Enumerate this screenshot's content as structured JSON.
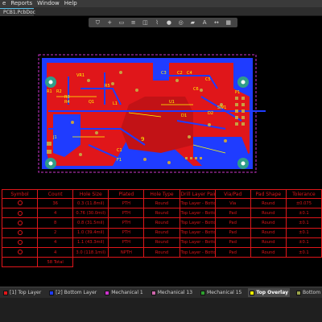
{
  "menu": [
    "e",
    "Reports",
    "Window",
    "Help"
  ],
  "document_tab": {
    "label": "PCB1.PcbDoc"
  },
  "toolbar_icons": [
    "filter-icon",
    "add-icon",
    "select-icon",
    "align-icon",
    "place-icon",
    "route-icon",
    "pad-icon",
    "via-icon",
    "region-icon",
    "text-icon",
    "dimension-icon",
    "component-icon"
  ],
  "board": {
    "designators": [
      "VR1",
      "R1",
      "R2",
      "Q1",
      "C3",
      "C2",
      "C4",
      "C5",
      "C6",
      "R3",
      "R4",
      "R5",
      "D1",
      "J1",
      "L1",
      "U1",
      "P1",
      "F1",
      "C1",
      "D2",
      "SW1"
    ]
  },
  "drill_table": {
    "headers": [
      "Symbol",
      "Count",
      "Hole Size",
      "Plated",
      "Hole Type",
      "Drill Layer Pair",
      "Via/Pad",
      "Pad Shape",
      "Tolerance"
    ],
    "rows": [
      [
        "",
        "36",
        "0.3 (11.8mil)",
        "PTH",
        "Round",
        "Top Layer - Bottom Layer",
        "Via",
        "Round",
        "±0.075"
      ],
      [
        "",
        "4",
        "0.76 (30.0mil)",
        "PTH",
        "Round",
        "Top Layer - Bottom Layer",
        "Pad",
        "Round",
        "±0.1"
      ],
      [
        "",
        "8",
        "0.8 (31.5mil)",
        "PTH",
        "Round",
        "Top Layer - Bottom Layer",
        "Pad",
        "Round",
        "±0.1"
      ],
      [
        "",
        "2",
        "1.0 (39.4mil)",
        "PTH",
        "Round",
        "Top Layer - Bottom Layer",
        "Pad",
        "Round",
        "±0.1"
      ],
      [
        "",
        "4",
        "1.1 (43.3mil)",
        "PTH",
        "Round",
        "Top Layer - Bottom Layer",
        "Pad",
        "Round",
        "±0.1"
      ],
      [
        "",
        "4",
        "3.0 (118.1mil)",
        "NPTH",
        "Round",
        "Top Layer - Bottom Layer",
        "Pad",
        "Round",
        "±0.1"
      ]
    ],
    "total_label": "58 Total"
  },
  "layers": [
    {
      "label": "[1] Top Layer",
      "color": "#e0161a"
    },
    {
      "label": "[2] Bottom Layer",
      "color": "#1f3cff"
    },
    {
      "label": "Mechanical 1",
      "color": "#cc33cc"
    },
    {
      "label": "Mechanical 13",
      "color": "#cc66aa"
    },
    {
      "label": "Mechanical 15",
      "color": "#2e9f2e"
    },
    {
      "label": "Top Overlay",
      "color": "#ffff00",
      "active": true
    },
    {
      "label": "Bottom Overlay",
      "color": "#9aa34a"
    },
    {
      "label": "Top Paste",
      "color": "#7a7a7a"
    }
  ]
}
